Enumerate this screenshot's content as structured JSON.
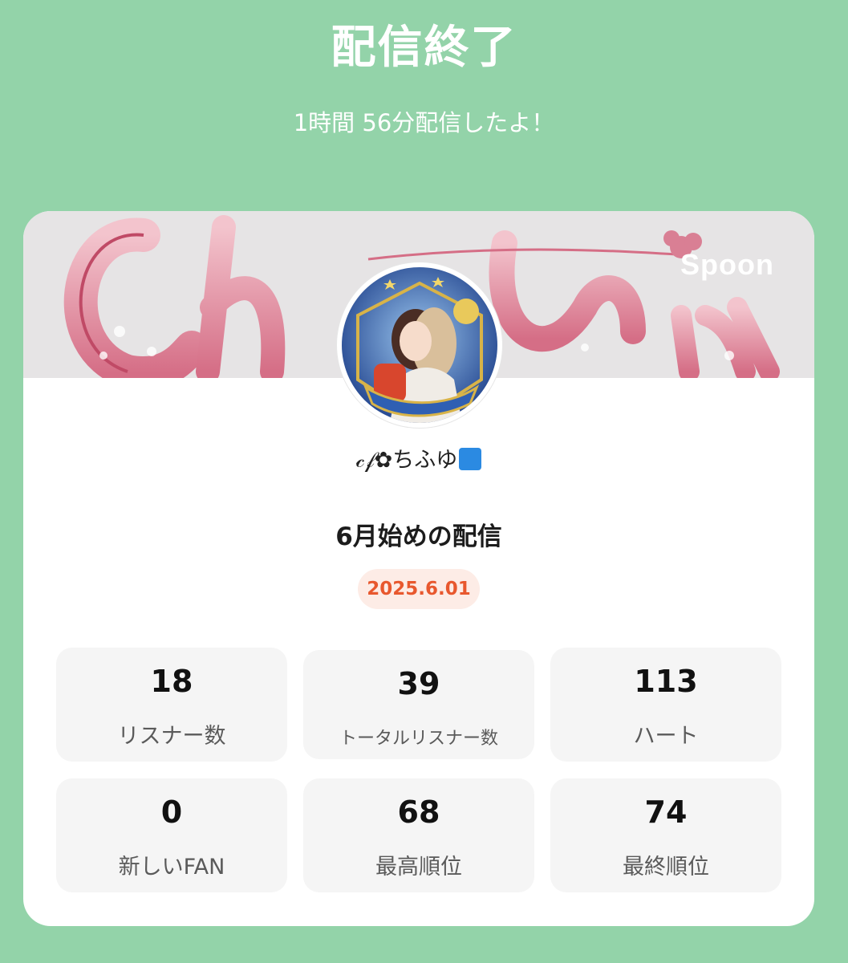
{
  "header": {
    "title": "配信終了",
    "subtitle": "1時間 56分配信したよ！"
  },
  "card": {
    "brand": "Spoon",
    "username": "𝒸𝒻✿ちふゆ",
    "stream_title": "6月始めの配信",
    "date": "2025.6.01",
    "stats": [
      {
        "value": "18",
        "label": "リスナー数"
      },
      {
        "value": "39",
        "label": "トータルリスナー数"
      },
      {
        "value": "113",
        "label": "ハート"
      },
      {
        "value": "0",
        "label": "新しいFAN"
      },
      {
        "value": "68",
        "label": "最高順位"
      },
      {
        "value": "74",
        "label": "最終順位"
      }
    ]
  },
  "colors": {
    "background": "#93d3a9",
    "date_badge_bg": "#fdece6",
    "date_text": "#e8582e"
  }
}
